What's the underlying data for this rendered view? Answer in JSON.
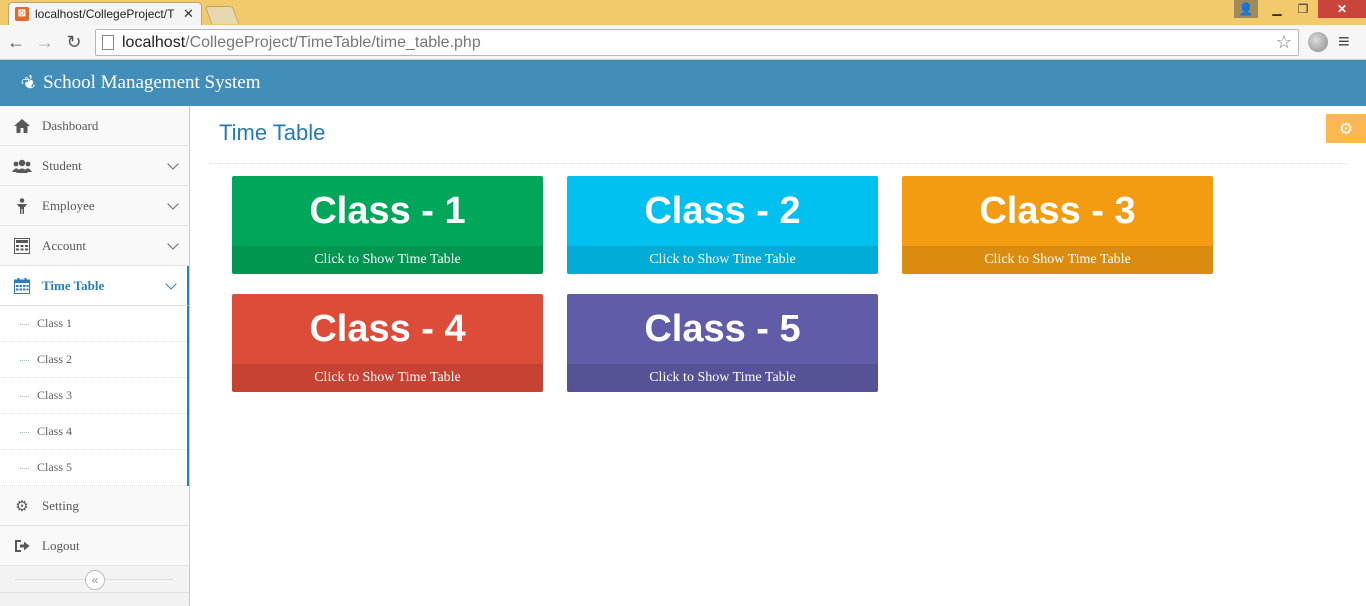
{
  "browser": {
    "tab_title": "localhost/CollegeProject/T",
    "url_host": "localhost",
    "url_path": "/CollegeProject/TimeTable/time_table.php"
  },
  "header": {
    "brand": "School Management System",
    "brand_icon": "leaf-icon"
  },
  "sidebar": {
    "items": [
      {
        "label": "Dashboard",
        "icon": "home-icon"
      },
      {
        "label": "Student",
        "icon": "users-icon"
      },
      {
        "label": "Employee",
        "icon": "employee-icon"
      },
      {
        "label": "Account",
        "icon": "calculator-icon"
      },
      {
        "label": "Time Table",
        "icon": "calendar-icon"
      },
      {
        "label": "Setting",
        "icon": "gear-icon"
      },
      {
        "label": "Logout",
        "icon": "sign-out-icon"
      }
    ],
    "submenu": [
      "Class 1",
      "Class 2",
      "Class 3",
      "Class 4",
      "Class 5"
    ]
  },
  "main": {
    "title": "Time Table",
    "cards": [
      {
        "title": "Class - 1",
        "footer": "Click to Show Time Table",
        "color": "#00a65a"
      },
      {
        "title": "Class - 2",
        "footer": "Click to Show Time Table",
        "color": "#00c0ef"
      },
      {
        "title": "Class - 3",
        "footer": "Click to Show Time Table",
        "color": "#f39c12"
      },
      {
        "title": "Class - 4",
        "footer": "Click to Show Time Table",
        "color": "#dd4b39"
      },
      {
        "title": "Class - 5",
        "footer": "Click to Show Time Table",
        "color": "#605ca8"
      }
    ]
  }
}
